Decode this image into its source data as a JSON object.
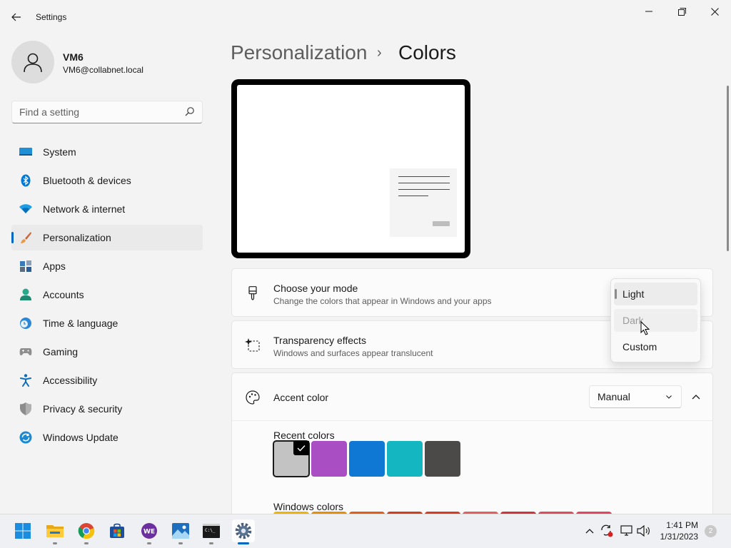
{
  "window": {
    "title": "Settings"
  },
  "profile": {
    "name": "VM6",
    "email": "VM6@collabnet.local"
  },
  "search": {
    "placeholder": "Find a setting"
  },
  "nav": {
    "items": [
      {
        "label": "System",
        "icon": "system-icon"
      },
      {
        "label": "Bluetooth & devices",
        "icon": "bluetooth-icon"
      },
      {
        "label": "Network & internet",
        "icon": "wifi-icon"
      },
      {
        "label": "Personalization",
        "icon": "brush-icon",
        "active": true
      },
      {
        "label": "Apps",
        "icon": "apps-icon"
      },
      {
        "label": "Accounts",
        "icon": "accounts-icon"
      },
      {
        "label": "Time & language",
        "icon": "time-language-icon"
      },
      {
        "label": "Gaming",
        "icon": "gamepad-icon"
      },
      {
        "label": "Accessibility",
        "icon": "accessibility-icon"
      },
      {
        "label": "Privacy & security",
        "icon": "shield-icon"
      },
      {
        "label": "Windows Update",
        "icon": "update-icon"
      }
    ]
  },
  "breadcrumb": {
    "parent": "Personalization",
    "separator": "›",
    "current": "Colors"
  },
  "mode_card": {
    "title": "Choose your mode",
    "description": "Change the colors that appear in Windows and your apps"
  },
  "transparency_card": {
    "title": "Transparency effects",
    "description": "Windows and surfaces appear translucent"
  },
  "accent_card": {
    "title": "Accent color",
    "dropdown_value": "Manual"
  },
  "recent_colors": {
    "label": "Recent colors",
    "swatches": [
      "#c3c3c3",
      "#a94fc3",
      "#0f78d4",
      "#14b6c2",
      "#4c4a48"
    ],
    "selected_index": 0
  },
  "windows_colors": {
    "label": "Windows colors",
    "swatches": [
      "#f0b400",
      "#e88e00",
      "#e35c11",
      "#d13e19",
      "#d83b1e",
      "#e45e5e",
      "#d13438",
      "#e04a59",
      "#e3455f"
    ]
  },
  "mode_flyout": {
    "options": [
      {
        "label": "Light",
        "state": "selected"
      },
      {
        "label": "Dark",
        "state": "hover"
      },
      {
        "label": "Custom",
        "state": "normal"
      }
    ]
  },
  "taskbar": {
    "apps": [
      "start-icon",
      "file-explorer-icon",
      "chrome-icon",
      "store-icon",
      "webex-icon",
      "photos-icon",
      "terminal-icon",
      "settings-icon"
    ],
    "time": "1:41 PM",
    "date": "1/31/2023",
    "notification_count": "2"
  },
  "colors": {
    "accent": "#0067c0"
  }
}
